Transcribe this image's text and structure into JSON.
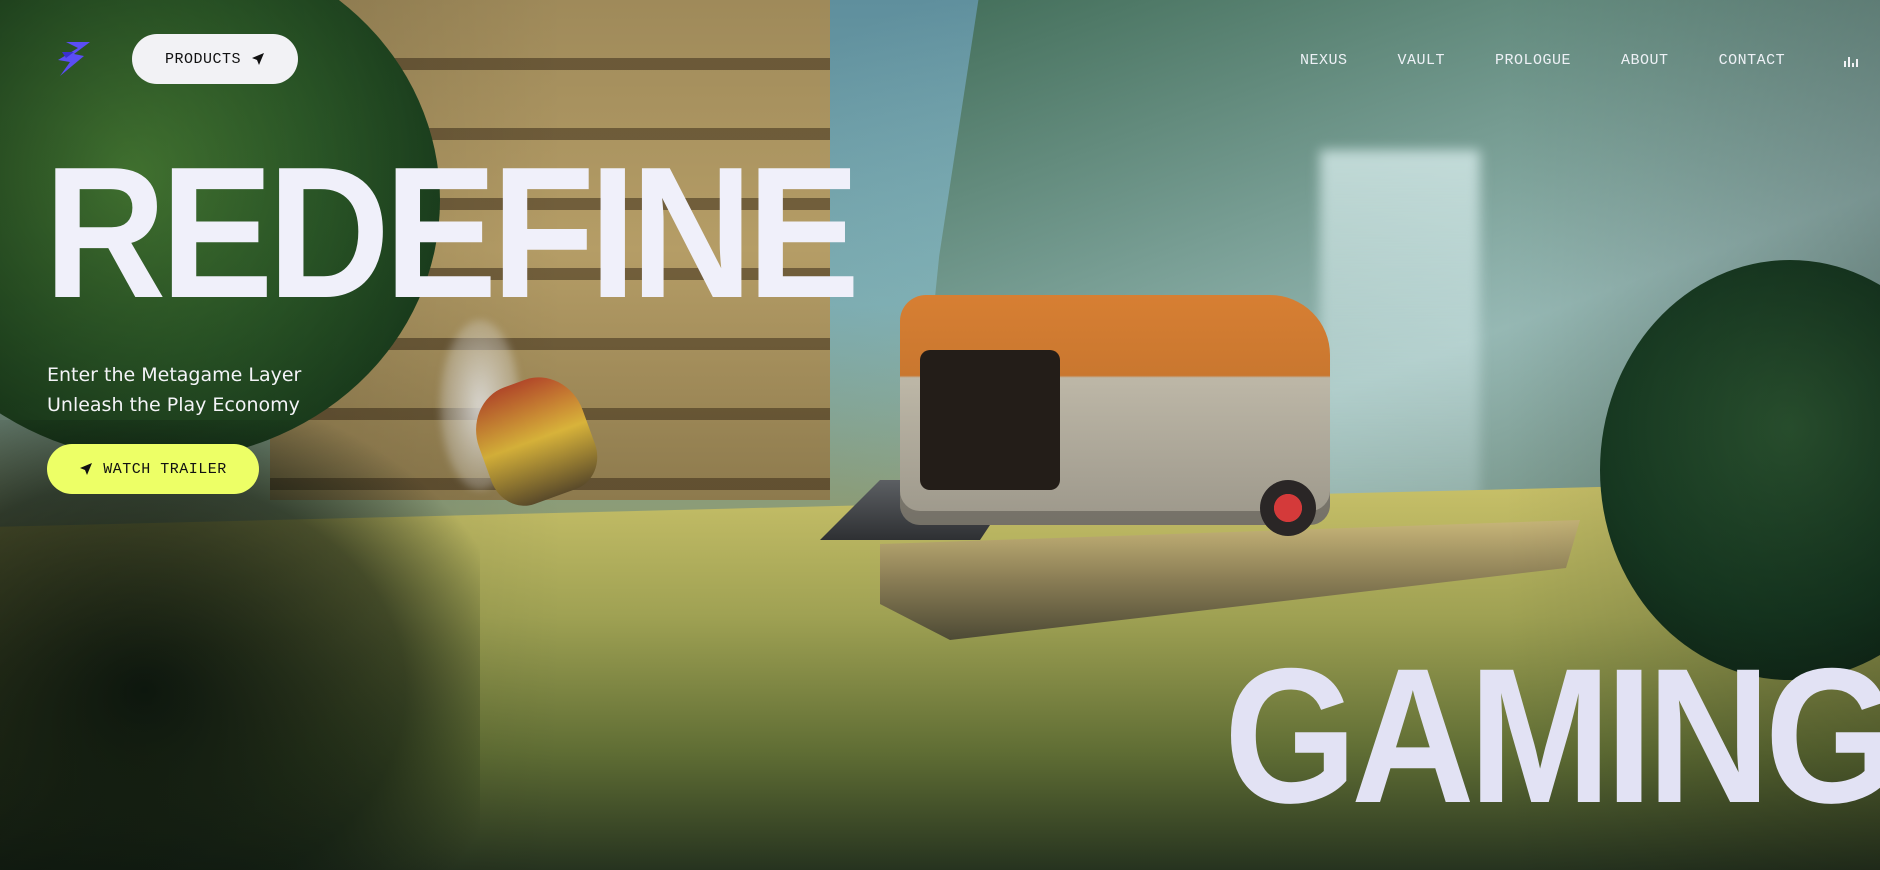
{
  "header": {
    "logo_icon": "lightning-bolt-logo",
    "products_label": "PRODUCTS",
    "products_icon": "location-arrow-icon",
    "nav": [
      "NEXUS",
      "VAULT",
      "PROLOGUE",
      "ABOUT",
      "CONTACT"
    ],
    "audio_icon": "audio-indicator-icon"
  },
  "hero": {
    "headline_top": "REDEFINE",
    "headline_bottom": "GAMING",
    "tagline_line1": "Enter the Metagame Layer",
    "tagline_line2": "Unleash the Play Economy",
    "cta_label": "WATCH TRAILER",
    "cta_icon": "location-arrow-icon"
  },
  "colors": {
    "accent": "#edff66",
    "logo": "#5b4df5",
    "headline": "#f0f0fa",
    "button_light": "#f2f2f5"
  }
}
